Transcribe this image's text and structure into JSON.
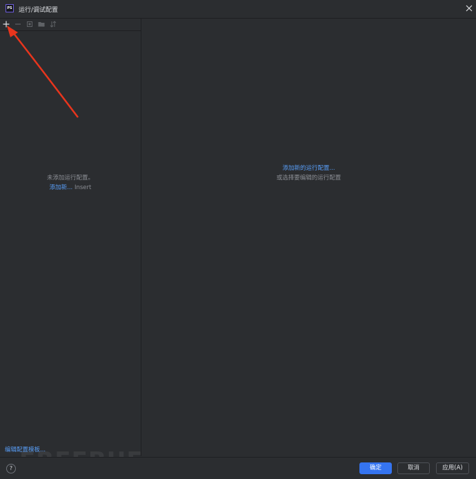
{
  "window": {
    "title": "运行/调试配置",
    "app_icon_text": "PS"
  },
  "toolbar": {
    "icons": [
      "plus-icon",
      "minus-icon",
      "copy-icon",
      "folder-icon",
      "sort-icon"
    ]
  },
  "left_panel": {
    "empty_text": "未添加运行配置。",
    "add_new_link": "添加新...",
    "add_new_shortcut": "Insert",
    "edit_templates_link": "编辑配置模板..."
  },
  "right_panel": {
    "add_new_config_link": "添加新的运行配置...",
    "or_select_text": "或选择要编辑的运行配置"
  },
  "footer": {
    "help_label": "?",
    "ok_label": "确定",
    "cancel_label": "取消",
    "apply_label": "应用(A)"
  },
  "watermark": "FREEBUF",
  "colors": {
    "background": "#2b2d30",
    "accent": "#3574f0",
    "link": "#589df6",
    "annotation_arrow": "#e8351d"
  }
}
